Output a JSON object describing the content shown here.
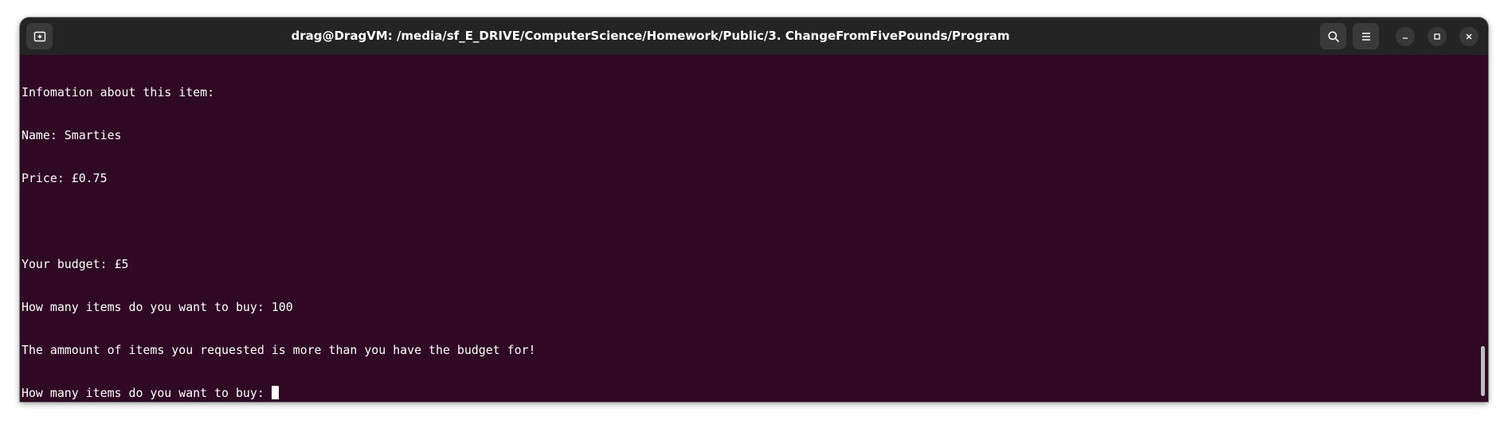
{
  "window": {
    "title": "drag@DragVM: /media/sf_E_DRIVE/ComputerScience/Homework/Public/3. ChangeFromFivePounds/Program"
  },
  "icons": {
    "new_tab": "new-tab-icon",
    "search": "search-icon",
    "menu": "hamburger-menu-icon",
    "minimize": "minimize-icon",
    "maximize": "maximize-icon",
    "close": "close-icon"
  },
  "terminal": {
    "lines": [
      "Infomation about this item:",
      "Name: Smarties",
      "Price: £0.75",
      "",
      "Your budget: £5",
      "How many items do you want to buy: 100",
      "The ammount of items you requested is more than you have the budget for!",
      "How many items do you want to buy:"
    ]
  },
  "colors": {
    "terminal_background": "#300a24",
    "titlebar_background": "#242424",
    "text": "#ffffff"
  }
}
